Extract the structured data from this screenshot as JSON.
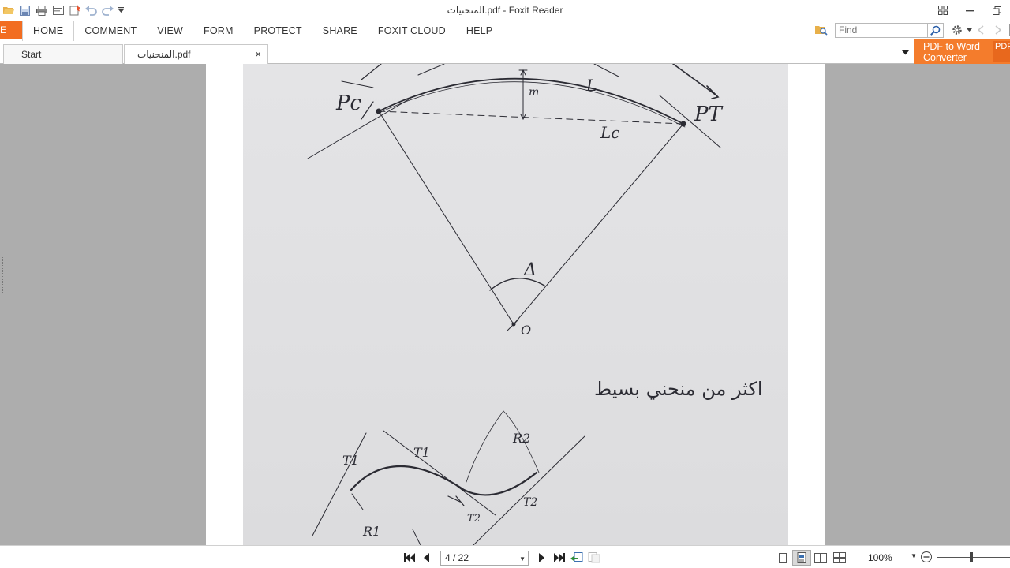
{
  "window": {
    "title": "المنحنيات.pdf - Foxit Reader"
  },
  "quick_access": {
    "icons": [
      "open-icon",
      "save-icon",
      "print-icon",
      "scan-icon",
      "new-icon",
      "undo-icon",
      "redo-icon",
      "customize-icon"
    ]
  },
  "ribbon": {
    "file_label": "E",
    "tabs": [
      {
        "label": "HOME"
      },
      {
        "label": "COMMENT"
      },
      {
        "label": "VIEW"
      },
      {
        "label": "FORM"
      },
      {
        "label": "PROTECT"
      },
      {
        "label": "SHARE"
      },
      {
        "label": "FOXIT CLOUD"
      },
      {
        "label": "HELP"
      }
    ],
    "active_tab": "HOME",
    "find_placeholder": "Find"
  },
  "doc_tabs": {
    "start_label": "Start",
    "doc_label": "المنحنيات.pdf",
    "close_glyph": "×"
  },
  "promo": {
    "line1": "PDF to Word",
    "line2": "Converter",
    "small": "PDF"
  },
  "drawing": {
    "labels": {
      "pc": "Pc",
      "pt": "PT",
      "m": "m",
      "l": "L",
      "lc": "Lc",
      "delta": "Δ",
      "o": "O"
    },
    "arabic_note": "اكثر من منحني بسيط",
    "lower_labels": {
      "t1_a": "T1",
      "t1_b": "T1",
      "r2": "R2",
      "t2_a": "T2",
      "t2_b": "T2",
      "r1": "R1"
    }
  },
  "status": {
    "page_display": "4 / 22",
    "zoom": "100%"
  },
  "colors": {
    "accent": "#f26d21",
    "workspace": "#adadad",
    "paper": "#e2e2e4",
    "ink": "#2b2b33"
  }
}
